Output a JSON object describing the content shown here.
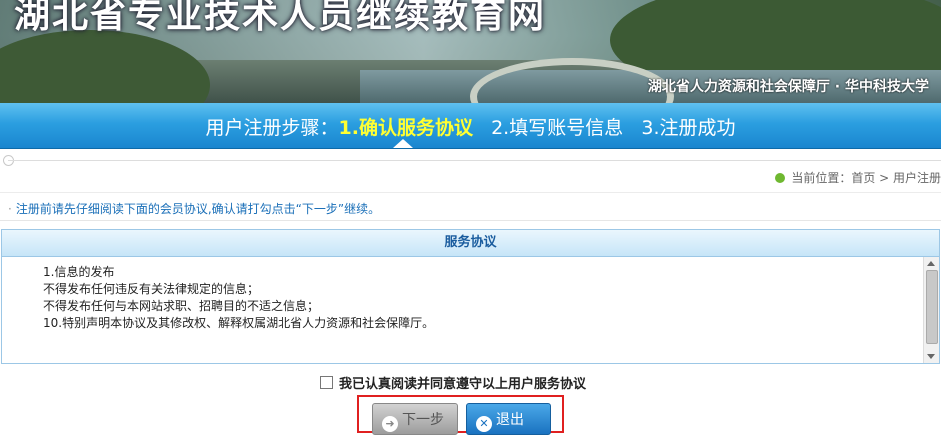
{
  "banner": {
    "title": "湖北省专业技术人员继续教育网",
    "subtitle": "湖北省人力资源和社会保障厅 · 华中科技大学"
  },
  "steps": {
    "prefix": "用户注册步骤：",
    "items": [
      "1.确认服务协议",
      "2.填写账号信息",
      "3.注册成功"
    ],
    "active_index": 0
  },
  "location": {
    "text": "当前位置：首页 > 用户注册"
  },
  "notice": {
    "text": "注册前请先仔细阅读下面的会员协议,确认请打勾点击“下一步”继续。"
  },
  "agreement": {
    "header": "服务协议",
    "lines": [
      "1.信息的发布",
      "不得发布任何违反有关法律规定的信息；",
      "不得发布任何与本网站求职、招聘目的不适之信息；",
      "10.特别声明本协议及其修改权、解释权属湖北省人力资源和社会保障厅。"
    ]
  },
  "consent": {
    "label": "我已认真阅读并同意遵守以上用户服务协议",
    "checked": false
  },
  "buttons": {
    "next_label": "下一步",
    "exit_label": "退出"
  },
  "colors": {
    "steps_bar": "#2b9ee0",
    "active_step": "#ffff33",
    "agreement_header_text": "#1a5c9e",
    "highlight_frame": "#e02020"
  }
}
